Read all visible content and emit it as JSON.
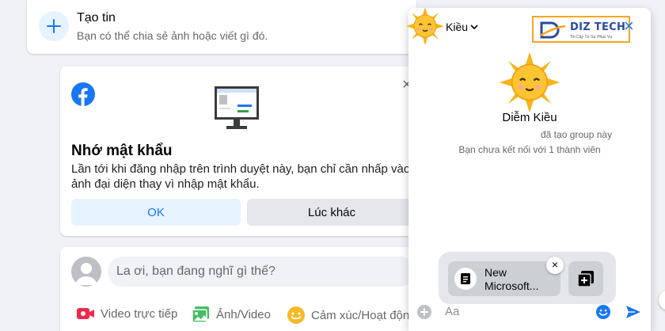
{
  "story": {
    "title": "Tạo tin",
    "subtitle": "Bạn có thể chia sẻ ảnh hoặc viết gì đó."
  },
  "remember_password": {
    "title": "Nhớ mật khẩu",
    "description": "Lần tới khi đăng nhập trên trình duyệt này, bạn chỉ cần nhấp vào ảnh đại diện thay vì nhập mật khẩu.",
    "ok_label": "OK",
    "later_label": "Lúc khác",
    "close_glyph": "×"
  },
  "composer": {
    "placeholder": "La ơi, bạn đang nghĩ gì thế?",
    "actions": [
      {
        "label": "Video trực tiếp",
        "icon": "live-video-icon"
      },
      {
        "label": "Ảnh/Video",
        "icon": "photo-icon"
      },
      {
        "label": "Cảm xúc/Hoạt động",
        "icon": "feeling-icon"
      }
    ]
  },
  "chat": {
    "name": "Kiều",
    "member_name": "Diễm Kiều",
    "created_text": "đã tạo group này",
    "connection_text": "Bạn chưa kết nối với 1 thành viên",
    "attachment_name": "New Microsoft...",
    "input_placeholder": "Aa",
    "close_glyph": "×",
    "watermark_text": "DIZ TECH",
    "watermark_sub": "Tin Cậy Từ Sự Phục Vụ"
  },
  "colors": {
    "brand": "#1877f2",
    "background": "#f0f2f5",
    "sun": "#f7b41b"
  }
}
